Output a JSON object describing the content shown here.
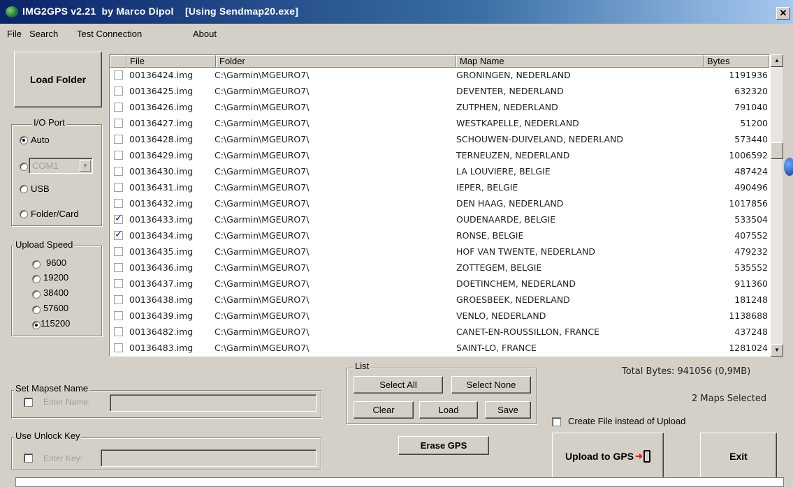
{
  "window": {
    "title": "IMG2GPS v2.21  by Marco Dipol    [Using Sendmap20.exe]",
    "close_glyph": "✕"
  },
  "menu": [
    "File",
    "Search",
    "Test Connection",
    "About"
  ],
  "left": {
    "load_folder": "Load Folder",
    "io_port": {
      "label": "I/O Port",
      "options": [
        "Auto",
        "COM1",
        "USB",
        "Folder/Card"
      ],
      "selected": "Auto",
      "com_value": "COM1"
    },
    "upload_speed": {
      "label": "Upload Speed",
      "options": [
        "9600",
        "19200",
        "38400",
        "57600",
        "115200"
      ],
      "selected": "115200"
    }
  },
  "list": {
    "headers": [
      "File",
      "Folder",
      "Map Name",
      "Bytes"
    ],
    "rows": [
      {
        "checked": false,
        "file": "00136424.img",
        "folder": "C:\\Garmin\\MGEURO7\\",
        "map": "GRONINGEN, NEDERLAND",
        "bytes": "1191936"
      },
      {
        "checked": false,
        "file": "00136425.img",
        "folder": "C:\\Garmin\\MGEURO7\\",
        "map": "DEVENTER, NEDERLAND",
        "bytes": "632320"
      },
      {
        "checked": false,
        "file": "00136426.img",
        "folder": "C:\\Garmin\\MGEURO7\\",
        "map": "ZUTPHEN, NEDERLAND",
        "bytes": "791040"
      },
      {
        "checked": false,
        "file": "00136427.img",
        "folder": "C:\\Garmin\\MGEURO7\\",
        "map": "WESTKAPELLE, NEDERLAND",
        "bytes": "51200"
      },
      {
        "checked": false,
        "file": "00136428.img",
        "folder": "C:\\Garmin\\MGEURO7\\",
        "map": "SCHOUWEN-DUIVELAND, NEDERLAND",
        "bytes": "573440"
      },
      {
        "checked": false,
        "file": "00136429.img",
        "folder": "C:\\Garmin\\MGEURO7\\",
        "map": "TERNEUZEN, NEDERLAND",
        "bytes": "1006592"
      },
      {
        "checked": false,
        "file": "00136430.img",
        "folder": "C:\\Garmin\\MGEURO7\\",
        "map": "LA LOUVIERE, BELGIE",
        "bytes": "487424"
      },
      {
        "checked": false,
        "file": "00136431.img",
        "folder": "C:\\Garmin\\MGEURO7\\",
        "map": "IEPER, BELGIE",
        "bytes": "490496"
      },
      {
        "checked": false,
        "file": "00136432.img",
        "folder": "C:\\Garmin\\MGEURO7\\",
        "map": "DEN HAAG, NEDERLAND",
        "bytes": "1017856"
      },
      {
        "checked": true,
        "file": "00136433.img",
        "folder": "C:\\Garmin\\MGEURO7\\",
        "map": "OUDENAARDE, BELGIE",
        "bytes": "533504"
      },
      {
        "checked": true,
        "file": "00136434.img",
        "folder": "C:\\Garmin\\MGEURO7\\",
        "map": "RONSE, BELGIE",
        "bytes": "407552"
      },
      {
        "checked": false,
        "file": "00136435.img",
        "folder": "C:\\Garmin\\MGEURO7\\",
        "map": "HOF VAN TWENTE, NEDERLAND",
        "bytes": "479232"
      },
      {
        "checked": false,
        "file": "00136436.img",
        "folder": "C:\\Garmin\\MGEURO7\\",
        "map": "ZOTTEGEM, BELGIE",
        "bytes": "535552"
      },
      {
        "checked": false,
        "file": "00136437.img",
        "folder": "C:\\Garmin\\MGEURO7\\",
        "map": "DOETINCHEM, NEDERLAND",
        "bytes": "911360"
      },
      {
        "checked": false,
        "file": "00136438.img",
        "folder": "C:\\Garmin\\MGEURO7\\",
        "map": "GROESBEEK, NEDERLAND",
        "bytes": "181248"
      },
      {
        "checked": false,
        "file": "00136439.img",
        "folder": "C:\\Garmin\\MGEURO7\\",
        "map": "VENLO, NEDERLAND",
        "bytes": "1138688"
      },
      {
        "checked": false,
        "file": "00136482.img",
        "folder": "C:\\Garmin\\MGEURO7\\",
        "map": "CANET-EN-ROUSSILLON, FRANCE",
        "bytes": "437248"
      },
      {
        "checked": false,
        "file": "00136483.img",
        "folder": "C:\\Garmin\\MGEURO7\\",
        "map": "SAINT-LO, FRANCE",
        "bytes": "1281024"
      }
    ]
  },
  "mapset": {
    "label": "Set Mapset Name",
    "placeholder": "Enter Name:"
  },
  "unlock": {
    "label": "Use Unlock Key",
    "placeholder": "Enter Key:"
  },
  "list_group": {
    "label": "List",
    "select_all": "Select All",
    "select_none": "Select None",
    "clear": "Clear",
    "load": "Load",
    "save": "Save"
  },
  "erase_gps": "Erase GPS",
  "total_bytes": "Total Bytes: 941056 (0,9MB)",
  "maps_selected": "2 Maps Selected",
  "create_file": "Create File instead of Upload",
  "upload": "Upload to GPS",
  "exit": "Exit"
}
